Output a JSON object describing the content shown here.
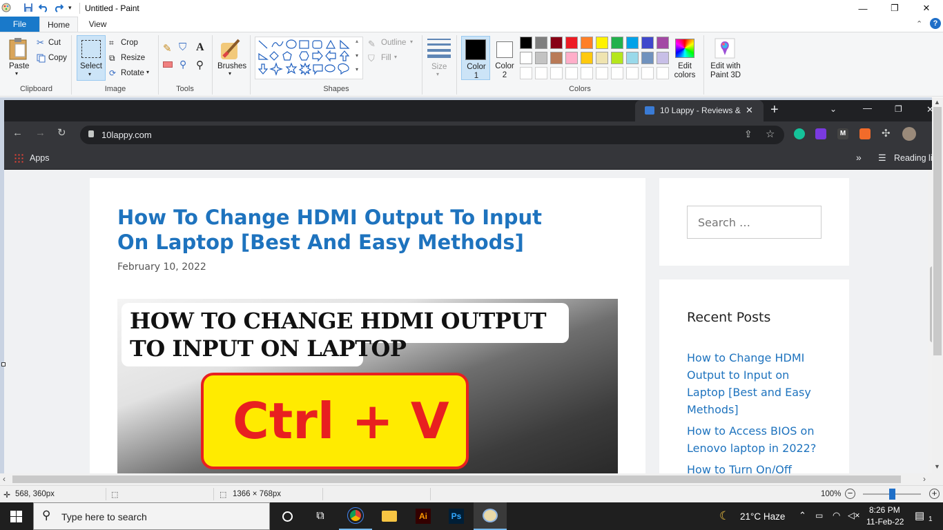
{
  "window": {
    "title": "Untitled - Paint",
    "minimize": "—",
    "restore": "❐",
    "close": "✕"
  },
  "ribbon": {
    "tabs": [
      {
        "label": "File"
      },
      {
        "label": "Home"
      },
      {
        "label": "View"
      }
    ],
    "clipboard": {
      "paste": "Paste",
      "cut": "Cut",
      "copy": "Copy",
      "label": "Clipboard"
    },
    "image": {
      "select": "Select",
      "crop": "Crop",
      "resize": "Resize",
      "rotate": "Rotate",
      "label": "Image"
    },
    "tools": {
      "label": "Tools"
    },
    "brushes": {
      "label": "Brushes"
    },
    "shapes": {
      "outline": "Outline",
      "fill": "Fill",
      "label": "Shapes"
    },
    "size": {
      "label": "Size"
    },
    "colors": {
      "color1": "Color 1",
      "color2": "Color 2",
      "edit_colors": "Edit colors",
      "edit_3d": "Edit with Paint 3D",
      "label": "Colors",
      "color1_value": "#000000",
      "color2_value": "#ffffff",
      "palette_row1": [
        "#000000",
        "#7f7f7f",
        "#880015",
        "#ed1c24",
        "#ff7f27",
        "#fff200",
        "#22b14c",
        "#00a2e8",
        "#3f48cc",
        "#a349a4"
      ],
      "palette_row2": [
        "#ffffff",
        "#c3c3c3",
        "#b97a57",
        "#ffaec9",
        "#ffc90e",
        "#efe4b0",
        "#b5e61d",
        "#99d9ea",
        "#7092be",
        "#c8bfe7"
      ]
    }
  },
  "browser": {
    "tab_title": "10 Lappy - Reviews & ",
    "url": "10lappy.com",
    "bookmarks_apps": "Apps",
    "reading_list": "Reading list"
  },
  "article": {
    "title": "How To Change HDMI Output To Input On Laptop [Best And Easy Methods]",
    "date": "February 10, 2022",
    "hero_text": "HOW TO CHANGE HDMI OUTPUT TO INPUT ON LAPTOP",
    "hero_shortcut": "Ctrl + V"
  },
  "sidebar": {
    "search_placeholder": "Search …",
    "recent_title": "Recent Posts",
    "recent_posts": [
      "How to Change HDMI Output to Input on Laptop [Best and Easy Methods]",
      "How to Access BIOS on Lenovo laptop in 2022?",
      "How to Turn On/Off"
    ]
  },
  "status": {
    "cursor": "568, 360px",
    "size": "1366 × 768px",
    "zoom": "100%",
    "zoom_fraction": 0.5
  },
  "taskbar": {
    "search": "Type here to search",
    "weather": "21°C  Haze",
    "time": "8:26 PM",
    "date": "11-Feb-22",
    "notifications": "1"
  }
}
